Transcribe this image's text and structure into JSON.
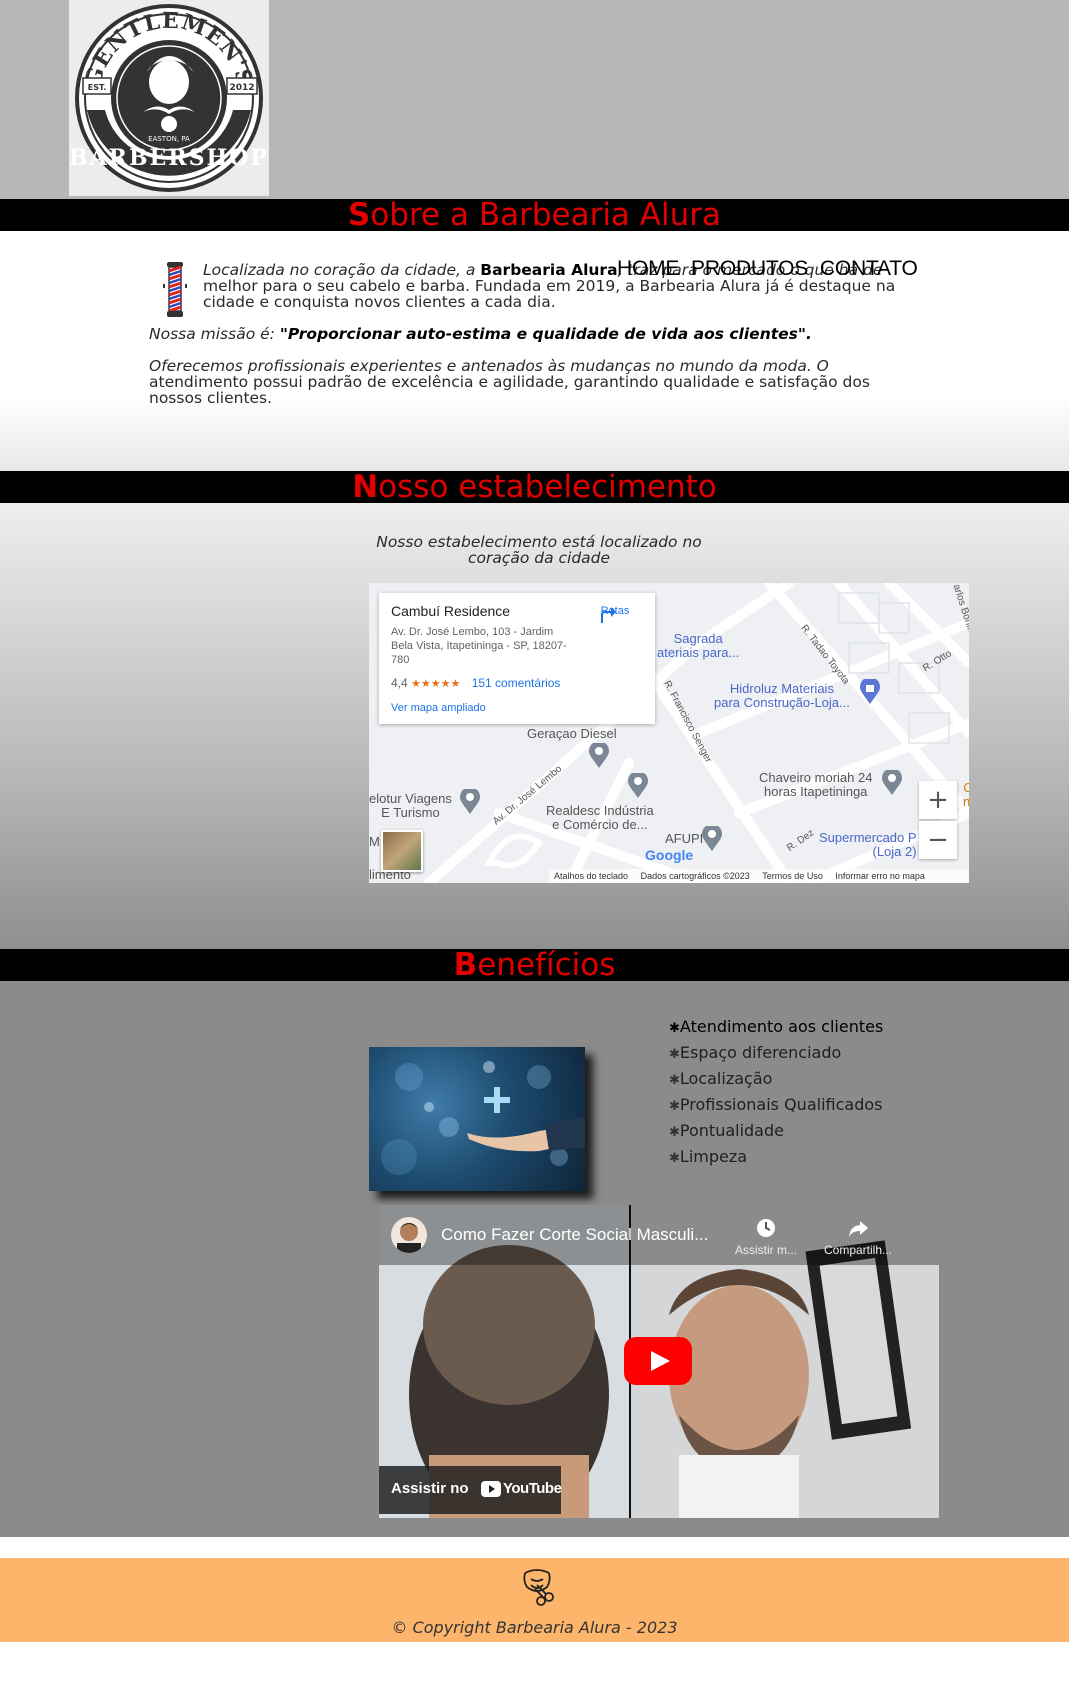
{
  "nav": {
    "home": "HOME",
    "produtos": "PRODUTOS",
    "contato": "CONTATO"
  },
  "logo": {
    "top": "GENTLEMEN'S",
    "bottom": "BARBERSHOP",
    "est": "EST.",
    "year": "2012",
    "place": "EASTON, PA"
  },
  "sobre": {
    "title_first": "S",
    "title_rest": "obre a Barbearia Alura",
    "p1_a": "Localizada no coração da cidade, a ",
    "p1_bold": "Barbearia Alura",
    "p1_b": ", traz para o mercado o que há de",
    "p1_c": "melhor para o seu cabelo e barba. Fundada em 2019, a Barbearia Alura já é destaque na",
    "p1_d": "cidade e conquista novos clientes a cada dia.",
    "p2_a": "Nossa missão é: ",
    "p2_bold": "\"Proporcionar auto-estima e qualidade de vida aos clientes\".",
    "p3_a": "Oferecemos profissionais experientes e antenados às mudanças no mundo da moda. O",
    "p3_b": "atendimento possui padrão de excelência e agilidade, garantindo qualidade e satisfação dos",
    "p3_c": "nossos clientes."
  },
  "estab": {
    "title_first": "N",
    "title_rest": "osso estabelecimento",
    "text_a": "Nosso estabelecimento está localizado no",
    "text_b": "coração da cidade"
  },
  "map": {
    "place_name": "Cambuí Residence",
    "address_a": "Av. Dr. José Lembo, 103 - Jardim",
    "address_b": "Bela Vista, Itapetininga - SP, 18207-",
    "address_c": "780",
    "directions": "Rotas",
    "rating": "4,4",
    "stars": "★★★★★",
    "reviews": "151 comentários",
    "bigger_map": "Ver mapa ampliado",
    "labels": {
      "sagrada_a": "Sagrada",
      "sagrada_b": "ateriais para...",
      "hidroluz_a": "Hidroluz Materiais",
      "hidroluz_b": "para Construção-Loja...",
      "geracao": "Geraçao Diesel",
      "chaveiro_a": "Chaveiro moriah 24",
      "chaveiro_b": "horas Itapetininga",
      "elotur_a": "elotur Viagens",
      "elotur_b": "E Turismo",
      "realdesc_a": "Realdesc Indústria",
      "realdesc_b": "e Comércio de...",
      "afupi": "AFUPI",
      "super_a": "Supermercado P",
      "super_b": "(Loja 2)",
      "limento": "limento",
      "m": "M",
      "o": "O",
      "nt": "nt"
    },
    "streets": {
      "tadao": "R. Tadao Toyota",
      "otto": "R. Otto",
      "bonini": "arlos Bonini",
      "francisco": "R. Francisco Senger",
      "lembo": "Av. Dr. José Lembo",
      "dez": "R. Dez"
    },
    "google": "Google",
    "footer": {
      "atalhos": "Atalhos do teclado",
      "dados": "Dados cartográficos ©2023",
      "termos": "Termos de Uso",
      "erro": "Informar erro no mapa"
    },
    "zoom_in": "+",
    "zoom_out": "−"
  },
  "benef": {
    "title_first": "B",
    "title_rest": "enefícios",
    "items": [
      "Atendimento aos clientes",
      "Espaço diferenciado",
      "Localização",
      "Profissionais Qualificados",
      "Pontualidade",
      "Limpeza"
    ],
    "bullet": "✱"
  },
  "video": {
    "title": "Como Fazer Corte Social Masculi...",
    "watch_later": "Assistir m...",
    "share": "Compartilh...",
    "watch_on": "Assistir no",
    "youtube": "YouTube"
  },
  "footer": {
    "copyright": "© Copyright Barbearia Alura - 2023"
  },
  "colors": {
    "accent": "#e00000",
    "footer": "#fdb56b",
    "header": "#b6b6b6"
  }
}
